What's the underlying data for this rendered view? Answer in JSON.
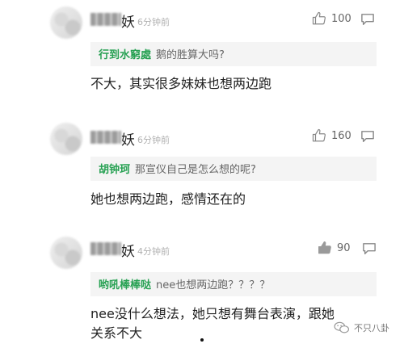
{
  "comments": [
    {
      "nickname_suffix": "妖",
      "time": "6分钟前",
      "likes": "100",
      "quote_author": "行到水窮處",
      "quote_text": "鹅的胜算大吗?",
      "body": "不大，其实很多妹妹也想两边跑"
    },
    {
      "nickname_suffix": "妖",
      "time": "6分钟前",
      "likes": "160",
      "quote_author": "胡钟珂",
      "quote_text": "那宣仪自己是怎么想的呢?",
      "body": "她也想两边跑，感情还在的"
    },
    {
      "nickname_suffix": "妖",
      "time": "4分钟前",
      "likes": "90",
      "quote_author": "哟吼棒棒哒",
      "quote_text": "nee也想两边跑？？？？",
      "body": "nee没什么想法，她只想有舞台表演，跟她关系不大"
    }
  ],
  "watermark": {
    "text": "不只八卦"
  },
  "colors": {
    "accent": "#27a153",
    "muted": "#b0b0b0",
    "quote_bg": "#f4f4f4"
  },
  "icons": {
    "like": "thumb-up-icon",
    "reply": "reply-bubble-icon",
    "watermark": "wechat-icon"
  }
}
